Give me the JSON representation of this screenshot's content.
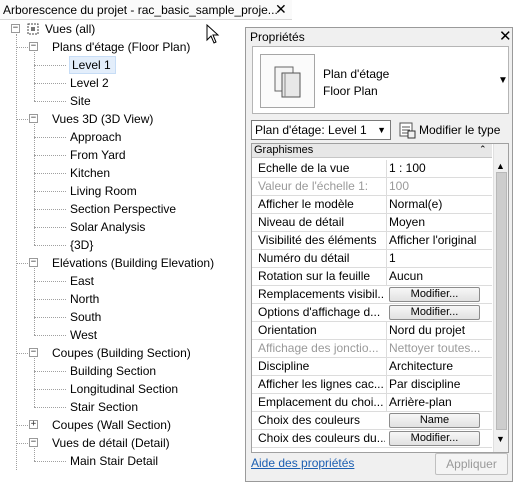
{
  "browser": {
    "title": "Arborescence du projet - rac_basic_sample_proje...",
    "close": "✕",
    "root": "Vues (all)",
    "groups": [
      {
        "label": "Plans d'étage (Floor Plan)",
        "items": [
          "Level 1",
          "Level 2",
          "Site"
        ]
      },
      {
        "label": "Vues 3D (3D View)",
        "items": [
          "Approach",
          "From Yard",
          "Kitchen",
          "Living Room",
          "Section Perspective",
          "Solar Analysis",
          "{3D}"
        ]
      },
      {
        "label": "Elévations (Building Elevation)",
        "items": [
          "East",
          "North",
          "South",
          "West"
        ]
      },
      {
        "label": "Coupes (Building Section)",
        "items": [
          "Building Section",
          "Longitudinal Section",
          "Stair Section"
        ]
      },
      {
        "label": "Coupes (Wall Section)",
        "items": []
      },
      {
        "label": "Vues de détail (Detail)",
        "items": [
          "Main Stair Detail"
        ]
      }
    ],
    "selected_item": "Level 1"
  },
  "properties": {
    "title": "Propriétés",
    "close": "✕",
    "type_name_1": "Plan d'étage",
    "type_name_2": "Floor Plan",
    "instance_filter": "Plan d'étage: Level 1",
    "edit_type": "Modifier le type",
    "group": "Graphismes",
    "rows": [
      {
        "name": "Echelle de la vue",
        "value": "1 : 100",
        "kind": "text"
      },
      {
        "name": "Valeur de l'échelle    1:",
        "value": "100",
        "kind": "disabled"
      },
      {
        "name": "Afficher le modèle",
        "value": "Normal(e)",
        "kind": "text"
      },
      {
        "name": "Niveau de détail",
        "value": "Moyen",
        "kind": "text"
      },
      {
        "name": "Visibilité des éléments",
        "value": "Afficher l'original",
        "kind": "text"
      },
      {
        "name": "Numéro du détail",
        "value": "1",
        "kind": "text"
      },
      {
        "name": "Rotation sur la feuille",
        "value": "Aucun",
        "kind": "text"
      },
      {
        "name": "Remplacements visibil...",
        "value": "Modifier...",
        "kind": "button"
      },
      {
        "name": "Options d'affichage d...",
        "value": "Modifier...",
        "kind": "button"
      },
      {
        "name": "Orientation",
        "value": "Nord du projet",
        "kind": "text"
      },
      {
        "name": "Affichage des jonctio...",
        "value": "Nettoyer toutes...",
        "kind": "disabled"
      },
      {
        "name": "Discipline",
        "value": "Architecture",
        "kind": "text"
      },
      {
        "name": "Afficher les lignes cac...",
        "value": "Par discipline",
        "kind": "text"
      },
      {
        "name": "Emplacement du choi...",
        "value": "Arrière-plan",
        "kind": "text"
      },
      {
        "name": "Choix des couleurs",
        "value": "Name",
        "kind": "button"
      },
      {
        "name": "Choix des couleurs du...",
        "value": "Modifier...",
        "kind": "button"
      }
    ],
    "help_link": "Aide des propriétés",
    "apply": "Appliquer"
  },
  "colors": {
    "selection": "#e3eefb",
    "link": "#1b5fb2",
    "disabled_text": "#9a9a9a"
  }
}
